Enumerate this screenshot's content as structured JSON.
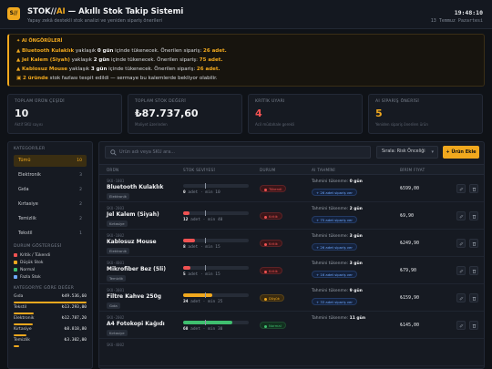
{
  "header": {
    "logo": "S//",
    "title_brand": "STOK//",
    "title_ai": "AI",
    "title_rest": " — Akıllı Stok Takip Sistemi",
    "subtitle": "Yapay zekâ destekli stok analizi ve yeniden sipariş önerileri",
    "time": "19:48:10",
    "date": "13 Temmuz Pazartesi"
  },
  "ai_panel": {
    "heading": "✦ AI ÖNGÖRÜLERİ",
    "lines": [
      {
        "icon": "warning-icon",
        "product": "Bluetooth Kulaklık",
        "t1": " yaklaşık ",
        "days": "0 gün",
        "t2": " içinde tükenecek. Önerilen sipariş: ",
        "qty": "26 adet."
      },
      {
        "icon": "warning-icon",
        "product": "Jel Kalem (Siyah)",
        "t1": " yaklaşık ",
        "days": "2 gün",
        "t2": " içinde tükenecek. Önerilen sipariş: ",
        "qty": "75 adet."
      },
      {
        "icon": "warning-icon",
        "product": "Kablosuz Mouse",
        "t1": " yaklaşık ",
        "days": "3 gün",
        "t2": " içinde tükenecek. Önerilen sipariş: ",
        "qty": "26 adet."
      }
    ],
    "excess": {
      "icon": "package-icon",
      "count": "2 üründe",
      "text": " stok fazlası tespit edildi — sermaye bu kalemlerde bekliyor olabilir."
    }
  },
  "kpis": [
    {
      "label": "TOPLAM ÜRÜN ÇEŞİDİ",
      "value": "10",
      "hint": "Aktif SKU sayısı",
      "color": "#f2f3f5"
    },
    {
      "label": "TOPLAM STOK DEĞERİ",
      "value": "₺87.737,60",
      "hint": "Maliyet üzerinden",
      "color": "#f2f3f5"
    },
    {
      "label": "KRİTİK UYARI",
      "value": "4",
      "hint": "Acil müdahale gerekli",
      "color": "#f05252"
    },
    {
      "label": "AI SİPARİŞ ÖNERİSİ",
      "value": "5",
      "hint": "Yeniden sipariş önerilen ürün",
      "color": "#f0a81e"
    }
  ],
  "sidebar": {
    "categories_title": "KATEGORİLER",
    "categories": [
      {
        "label": "Tümü",
        "count": "10"
      },
      {
        "label": "Elektronik",
        "count": "3"
      },
      {
        "label": "Gıda",
        "count": "2"
      },
      {
        "label": "Kırtasiye",
        "count": "2"
      },
      {
        "label": "Temizlik",
        "count": "2"
      },
      {
        "label": "Tekstil",
        "count": "1"
      }
    ],
    "legend_title": "DURUM GÖSTERGESİ",
    "legend": [
      {
        "label": "Kritik / Tükendi",
        "color": "#f05252"
      },
      {
        "label": "Düşük Stok",
        "color": "#f0a81e"
      },
      {
        "label": "Normal",
        "color": "#3fbf6f"
      },
      {
        "label": "Fazla Stok",
        "color": "#6ea8ff"
      }
    ],
    "values_title": "KATEGORİYE GÖRE DEĞER",
    "values": [
      {
        "label": "Gıda",
        "value": "₺49.536,60",
        "share": 1.0
      },
      {
        "label": "Tekstil",
        "value": "₺13.293,00",
        "share": 0.27
      },
      {
        "label": "Elektronik",
        "value": "₺12.787,20",
        "share": 0.26
      },
      {
        "label": "Kırtasiye",
        "value": "₺8.818,80",
        "share": 0.18
      },
      {
        "label": "Temizlik",
        "value": "₺3.302,00",
        "share": 0.07
      }
    ]
  },
  "toolbar": {
    "search_placeholder": "Ürün adı veya SKU ara...",
    "sort_label": "Sırala: Risk Önceliği",
    "sort_chevron": "▾",
    "add_label": "+ Ürün Ekle"
  },
  "table": {
    "headers": [
      "ÜRÜN",
      "STOK SEVİYESİ",
      "DURUM",
      "AI TAHMİNİ",
      "BİRİM FİYAT"
    ],
    "rows": [
      {
        "sku": "SKU-1001",
        "name": "Bluetooth Kulaklık",
        "category": "Elektronik",
        "stock": "0",
        "min": "min 10",
        "level": 0.0,
        "min_level": 0.33,
        "fill_color": "#f05252",
        "status": "Tükendi",
        "status_class": "b-crit",
        "eta_label": "Tahmini tükenme: ",
        "eta": "0 gün",
        "suggest": "+ 26 adet sipariş ver",
        "price": "₺599,00"
      },
      {
        "sku": "SKU-2003",
        "name": "Jel Kalem (Siyah)",
        "category": "Kırtasiye",
        "stock": "12",
        "min": "min 40",
        "level": 0.1,
        "min_level": 0.33,
        "fill_color": "#f05252",
        "status": "Kritik",
        "status_class": "b-crit",
        "eta_label": "Tahmini tükenme: ",
        "eta": "2 gün",
        "suggest": "+ 75 adet sipariş ver",
        "price": "₺9,90"
      },
      {
        "sku": "SKU-1002",
        "name": "Kablosuz Mouse",
        "category": "Elektronik",
        "stock": "8",
        "min": "min 15",
        "level": 0.18,
        "min_level": 0.33,
        "fill_color": "#f05252",
        "status": "Kritik",
        "status_class": "b-crit",
        "eta_label": "Tahmini tükenme: ",
        "eta": "3 gün",
        "suggest": "+ 26 adet sipariş ver",
        "price": "₺249,90"
      },
      {
        "sku": "SKU-4001",
        "name": "Mikrofiber Bez (5li)",
        "category": "Temizlik",
        "stock": "5",
        "min": "min 15",
        "level": 0.11,
        "min_level": 0.33,
        "fill_color": "#f05252",
        "status": "Kritik",
        "status_class": "b-crit",
        "eta_label": "Tahmini tükenme: ",
        "eta": "3 gün",
        "suggest": "+ 16 adet sipariş ver",
        "price": "₺79,90"
      },
      {
        "sku": "SKU-3001",
        "name": "Filtre Kahve 250g",
        "category": "Gıda",
        "stock": "34",
        "min": "min 25",
        "level": 0.45,
        "min_level": 0.33,
        "fill_color": "#f0a81e",
        "status": "Düşük",
        "status_class": "b-low",
        "eta_label": "Tahmini tükenme: ",
        "eta": "9 gün",
        "suggest": "+ 33 adet sipariş ver",
        "price": "₺159,90"
      },
      {
        "sku": "SKU-2002",
        "name": "A4 Fotokopi Kağıdı",
        "category": "Kırtasiye",
        "stock": "68",
        "min": "min 30",
        "level": 0.75,
        "min_level": 0.33,
        "fill_color": "#3fbf6f",
        "status": "Normal",
        "status_class": "b-norm",
        "eta_label": "Tahmini tükenme: ",
        "eta": "11 gün",
        "suggest": "",
        "price": "₺145,00"
      },
      {
        "sku": "SKU-4002",
        "name": "",
        "category": "",
        "stock": "",
        "min": "",
        "level": 0.0,
        "min_level": 0.33,
        "fill_color": "#3fbf6f",
        "status": "",
        "status_class": "",
        "eta_label": "",
        "eta": "",
        "suggest": "",
        "price": ""
      }
    ]
  }
}
